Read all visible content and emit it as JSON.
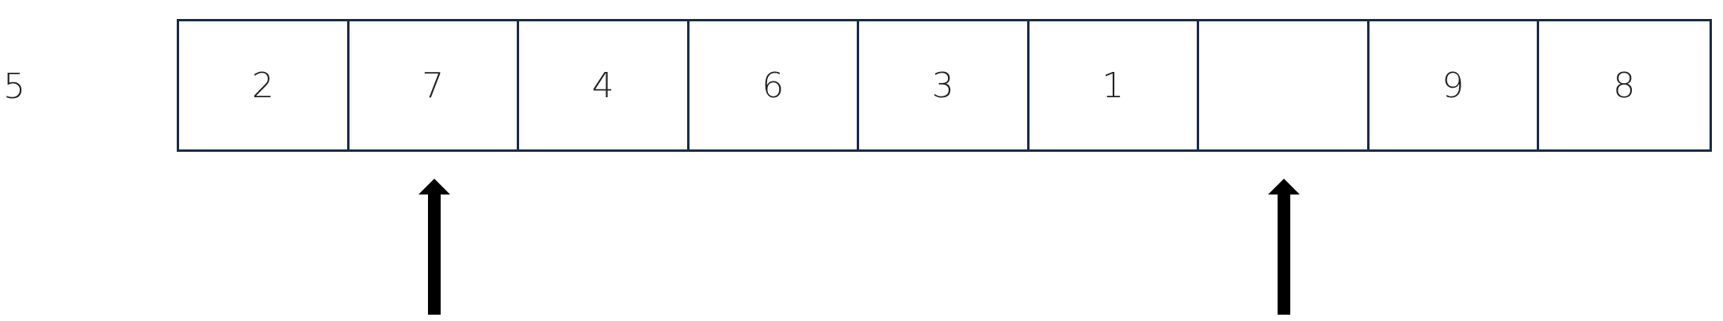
{
  "pivot": {
    "value": "5"
  },
  "array": {
    "cells": [
      "2",
      "7",
      "4",
      "6",
      "3",
      "1",
      "",
      "9",
      "8"
    ]
  },
  "pointers": [
    {
      "index": 1
    },
    {
      "index": 6
    }
  ],
  "colors": {
    "border": "#1b2a48",
    "text": "#222222",
    "arrow": "#000000"
  }
}
